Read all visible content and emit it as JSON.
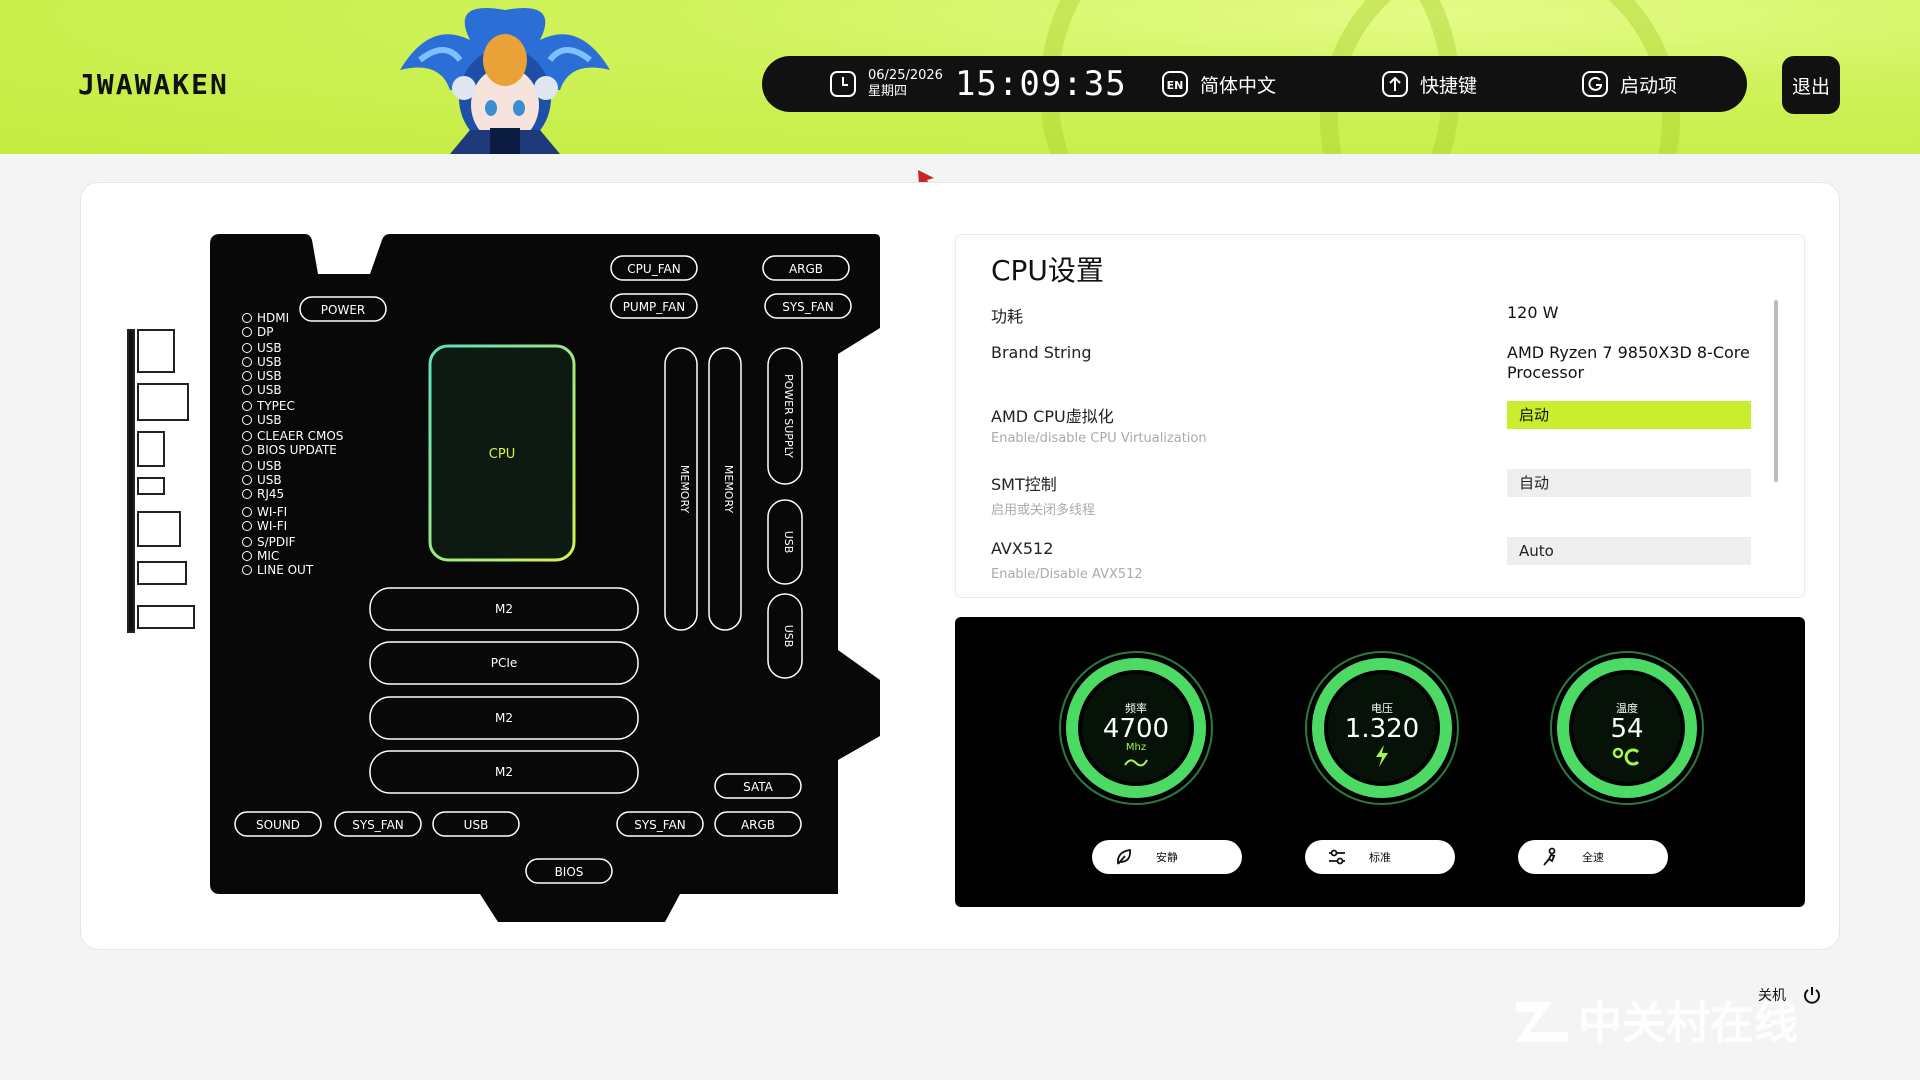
{
  "header": {
    "logo": "JWAWAKEN",
    "date": "06/25/2026",
    "weekday": "星期四",
    "time": "15:09:35",
    "lang_badge": "EN",
    "language": "简体中文",
    "shortcut": "快捷键",
    "boot": "启动项",
    "exit": "退出"
  },
  "motherboard": {
    "top_labels": [
      "POWER",
      "CPU_FAN",
      "ARGB",
      "PUMP_FAN",
      "SYS_FAN"
    ],
    "io_ports": [
      "HDMI",
      "DP",
      "USB",
      "USB",
      "USB",
      "USB",
      "TYPEC",
      "USB",
      "CLEAER CMOS",
      "BIOS UPDATE",
      "USB",
      "USB",
      "RJ45",
      "WI-FI",
      "WI-FI",
      "S/PDIF",
      "MIC",
      "LINE OUT"
    ],
    "cpu": "CPU",
    "memory": [
      "MEMORY",
      "MEMORY"
    ],
    "power_supply": "POWER SUPPLY",
    "side_usb": [
      "USB",
      "USB"
    ],
    "slots": [
      "M2",
      "PCIe",
      "M2",
      "M2"
    ],
    "sata": "SATA",
    "bottom_labels": [
      "SOUND",
      "SYS_FAN",
      "USB",
      "SYS_FAN",
      "ARGB"
    ],
    "bios": "BIOS"
  },
  "settings": {
    "title": "CPU设置",
    "rows": [
      {
        "label": "功耗",
        "value": "120 W"
      },
      {
        "label": "Brand String",
        "value": "AMD Ryzen 7 9850X3D 8-Core Processor"
      },
      {
        "label": "AMD CPU虚拟化",
        "sub": "Enable/disable CPU Virtualization",
        "value": "启动"
      },
      {
        "label": "SMT控制",
        "sub": "启用或关闭多线程",
        "value": "自动"
      },
      {
        "label": "AVX512",
        "sub": "Enable/Disable AVX512",
        "value": "Auto"
      }
    ]
  },
  "gauges": [
    {
      "label": "频率",
      "value": "4700",
      "unit": "Mhz"
    },
    {
      "label": "电压",
      "value": "1.320"
    },
    {
      "label": "温度",
      "value": "54"
    }
  ],
  "modes": [
    "安静",
    "标准",
    "全速"
  ],
  "footer": {
    "shutdown": "关机",
    "watermark": "中关村在线"
  },
  "colors": {
    "accent": "#c8ee2e",
    "gauge_green": "#4cd964",
    "dark": "#111111"
  }
}
